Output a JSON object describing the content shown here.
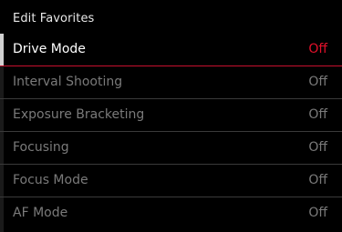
{
  "header": {
    "title": "Edit Favorites"
  },
  "menu": {
    "items": [
      {
        "label": "Drive Mode",
        "value": "Off"
      },
      {
        "label": "Interval Shooting",
        "value": "Off"
      },
      {
        "label": "Exposure Bracketing",
        "value": "Off"
      },
      {
        "label": "Focusing",
        "value": "Off"
      },
      {
        "label": "Focus Mode",
        "value": "Off"
      },
      {
        "label": "AF Mode",
        "value": "Off"
      }
    ],
    "selected_index": 0
  },
  "colors": {
    "background": "#000000",
    "selected_text": "#ffffff",
    "selected_value": "#e3102a",
    "inactive_text": "#7a7a7a",
    "accent_line": "#c8102e"
  }
}
